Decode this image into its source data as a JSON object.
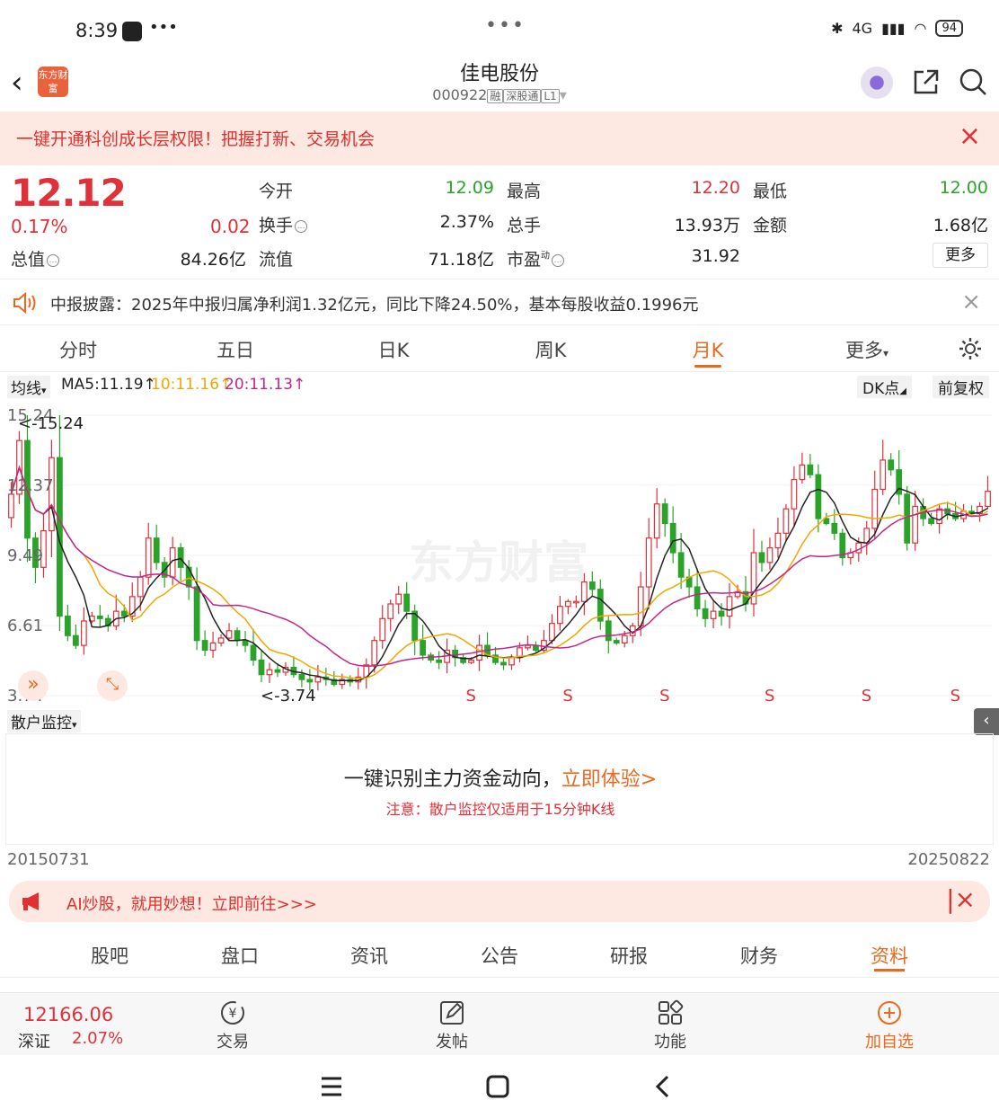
{
  "status": {
    "time": "8:39",
    "network": "4G",
    "battery": "94"
  },
  "header": {
    "stock_name": "佳电股份",
    "stock_code": "000922",
    "tags": [
      "融",
      "深股通",
      "L1"
    ],
    "logo_text": "东方财富"
  },
  "banner": {
    "text": "一键开通科创成长层权限！把握打新、交易机会"
  },
  "quote": {
    "price": "12.12",
    "change_pct": "0.17%",
    "change_amt": "0.02",
    "fields": {
      "open_label": "今开",
      "open": "12.09",
      "high_label": "最高",
      "high": "12.20",
      "low_label": "最低",
      "low": "12.00",
      "turnover_label": "换手",
      "turnover": "2.37%",
      "volume_label": "总手",
      "volume": "13.93万",
      "amount_label": "金额",
      "amount": "1.68亿",
      "mktcap_label": "总值",
      "mktcap": "84.26亿",
      "float_label": "流值",
      "float": "71.18亿",
      "pe_label": "市盈",
      "pe_sup": "动",
      "pe": "31.92"
    },
    "more_label": "更多"
  },
  "news": {
    "text": "中报披露：2025年中报归属净利润1.32亿元，同比下降24.50%，基本每股收益0.1996元"
  },
  "tabs": [
    "分时",
    "五日",
    "日K",
    "周K",
    "月K",
    "更多"
  ],
  "active_tab": "月K",
  "ma": {
    "select": "均线",
    "ma5": "MA5:11.19",
    "ma10": "10:11.16",
    "ma20": "20:11.13",
    "dk": "DK点",
    "fq": "前复权"
  },
  "chart_data": {
    "type": "candlestick",
    "y_ticks": [
      "15.24",
      "12.37",
      "9.49",
      "6.61",
      "3.74"
    ],
    "ylim": [
      3.74,
      15.24
    ],
    "max_label": "<-15.24",
    "min_label": "<-3.74",
    "signal_label": "S",
    "signals_at_index": [
      57,
      69,
      81,
      94,
      106,
      117
    ],
    "watermark": "东方财富",
    "colors": {
      "up": "#e0303a",
      "down": "#2ba32b",
      "ma5": "#222222",
      "ma10": "#f0a800",
      "ma20": "#c3268a"
    },
    "close": [
      12.0,
      14.2,
      10.2,
      9.0,
      10.5,
      13.5,
      7.0,
      6.2,
      5.8,
      6.8,
      7.0,
      6.9,
      6.6,
      7.2,
      7.0,
      7.8,
      8.6,
      10.2,
      9.2,
      8.6,
      9.8,
      9.0,
      8.2,
      6.0,
      5.6,
      5.9,
      6.1,
      6.4,
      6.0,
      5.8,
      5.2,
      4.6,
      4.8,
      4.7,
      4.9,
      4.6,
      4.4,
      4.3,
      4.5,
      4.4,
      4.2,
      4.4,
      4.3,
      4.5,
      5.0,
      6.0,
      6.9,
      7.5,
      7.9,
      7.2,
      6.0,
      5.4,
      5.2,
      5.1,
      5.6,
      5.3,
      5.1,
      5.2,
      5.8,
      5.4,
      5.1,
      5.0,
      5.3,
      5.7,
      5.8,
      5.6,
      6.0,
      6.7,
      7.4,
      7.6,
      7.6,
      8.4,
      8.1,
      6.8,
      6.0,
      5.9,
      6.2,
      6.6,
      8.2,
      10.2,
      11.6,
      10.8,
      9.6,
      8.6,
      8.2,
      7.3,
      6.9,
      7.2,
      7.0,
      7.8,
      8.0,
      7.5,
      9.6,
      9.2,
      9.8,
      10.4,
      11.4,
      12.6,
      13.2,
      12.8,
      11.0,
      10.8,
      10.4,
      9.4,
      9.6,
      10.0,
      10.6,
      12.2,
      13.4,
      13.0,
      12.0,
      10.0,
      11.5,
      11.0,
      10.8,
      11.4,
      11.2,
      11.0,
      11.3,
      11.2,
      11.5,
      12.12
    ]
  },
  "monitor": {
    "select": "散户监控",
    "title": "一键识别主力资金动向，",
    "link": "立即体验>",
    "note": "注意：散户监控仅适用于15分钟K线"
  },
  "dates": {
    "start": "20150731",
    "end": "20250822"
  },
  "ai": {
    "text": "AI炒股，就用妙想！立即前往>>>"
  },
  "bottom_tabs": [
    "股吧",
    "盘口",
    "资讯",
    "公告",
    "研报",
    "财务",
    "资料"
  ],
  "active_bottom_tab": "资料",
  "index": {
    "value": "12166.06",
    "name": "深证",
    "pct": "2.07%"
  },
  "nav": {
    "trade": "交易",
    "post": "发帖",
    "func": "功能",
    "add": "加自选"
  }
}
